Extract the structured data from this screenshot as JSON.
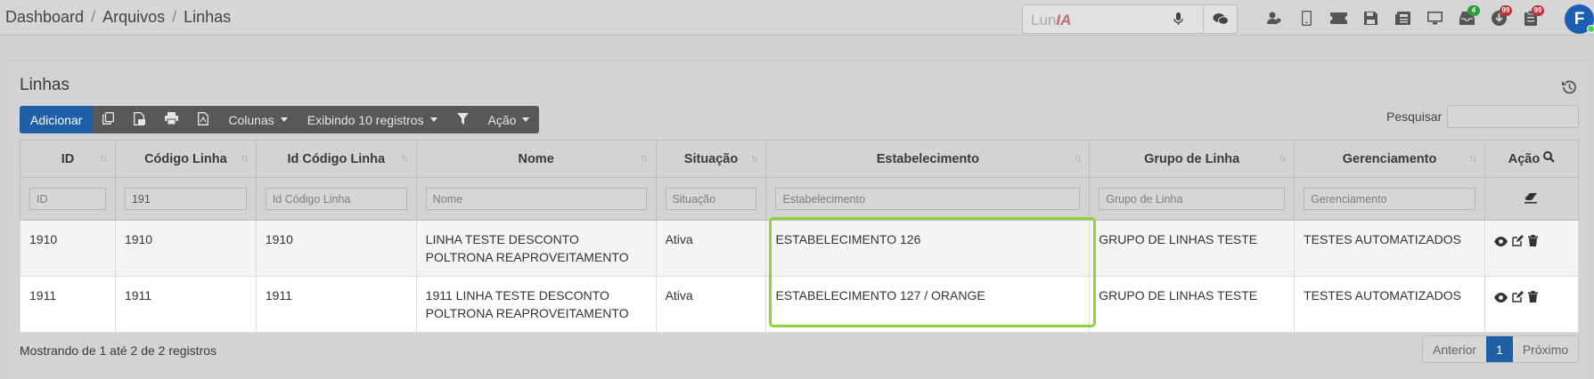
{
  "breadcrumb": {
    "items": [
      "Dashboard",
      "Arquivos",
      "Linhas"
    ],
    "sep": "/"
  },
  "assistant": {
    "placeholder_prefix": "Lun",
    "placeholder_suffix": "IA"
  },
  "topbar_badges": {
    "green": "4",
    "red1": "99",
    "red2": "99"
  },
  "user": {
    "initial": "F"
  },
  "colors": {
    "primary": "#1e5fa8",
    "highlight": "#8fd140",
    "badge_green": "#2e9e3b",
    "badge_red": "#c0303a"
  },
  "page": {
    "title": "Linhas"
  },
  "toolbar": {
    "add": "Adicionar",
    "columns": "Colunas",
    "showing": "Exibindo 10 registros",
    "action": "Ação"
  },
  "search": {
    "label": "Pesquisar",
    "value": ""
  },
  "table": {
    "headers": [
      "ID",
      "Código Linha",
      "Id Código Linha",
      "Nome",
      "Situação",
      "Estabelecimento",
      "Grupo de Linha",
      "Gerenciamento",
      "Ação"
    ],
    "filters": [
      {
        "placeholder": "ID",
        "value": ""
      },
      {
        "placeholder": "Código Linha",
        "value": "191"
      },
      {
        "placeholder": "Id Código Linha",
        "value": ""
      },
      {
        "placeholder": "Nome",
        "value": ""
      },
      {
        "placeholder": "Situação",
        "value": ""
      },
      {
        "placeholder": "Estabelecimento",
        "value": ""
      },
      {
        "placeholder": "Grupo de Linha",
        "value": ""
      },
      {
        "placeholder": "Gerenciamento",
        "value": ""
      }
    ],
    "rows": [
      {
        "id": "1910",
        "codigo": "1910",
        "id_codigo": "1910",
        "nome": "LINHA TESTE DESCONTO POLTRONA REAPROVEITAMENTO",
        "situacao": "Ativa",
        "estabelecimento": "ESTABELECIMENTO 126",
        "grupo": "GRUPO DE LINHAS TESTE",
        "gerenciamento": "TESTES AUTOMATIZADOS"
      },
      {
        "id": "1911",
        "codigo": "1911",
        "id_codigo": "1911",
        "nome": "1911 LINHA TESTE DESCONTO POLTRONA REAPROVEITAMENTO",
        "situacao": "Ativa",
        "estabelecimento": "ESTABELECIMENTO 127 / ORANGE",
        "grupo": "GRUPO DE LINHAS TESTE",
        "gerenciamento": "TESTES AUTOMATIZADOS"
      }
    ]
  },
  "footer": {
    "info": "Mostrando de 1 até 2 de 2 registros"
  },
  "pagination": {
    "prev": "Anterior",
    "current": "1",
    "next": "Próximo"
  }
}
